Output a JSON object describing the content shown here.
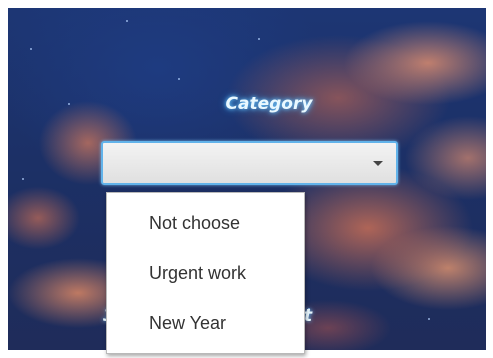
{
  "form": {
    "category_label": "Category",
    "category_value": "",
    "behind_text_left": "3",
    "behind_text_right": "t"
  },
  "dropdown": {
    "options": [
      "Not choose",
      "Urgent work",
      "New Year"
    ]
  },
  "icons": {
    "combo_arrow": "chevron-down-icon"
  },
  "colors": {
    "label_glow": "#6fc8ff",
    "combo_border": "#62b3ea",
    "sky": "#1d3674"
  }
}
